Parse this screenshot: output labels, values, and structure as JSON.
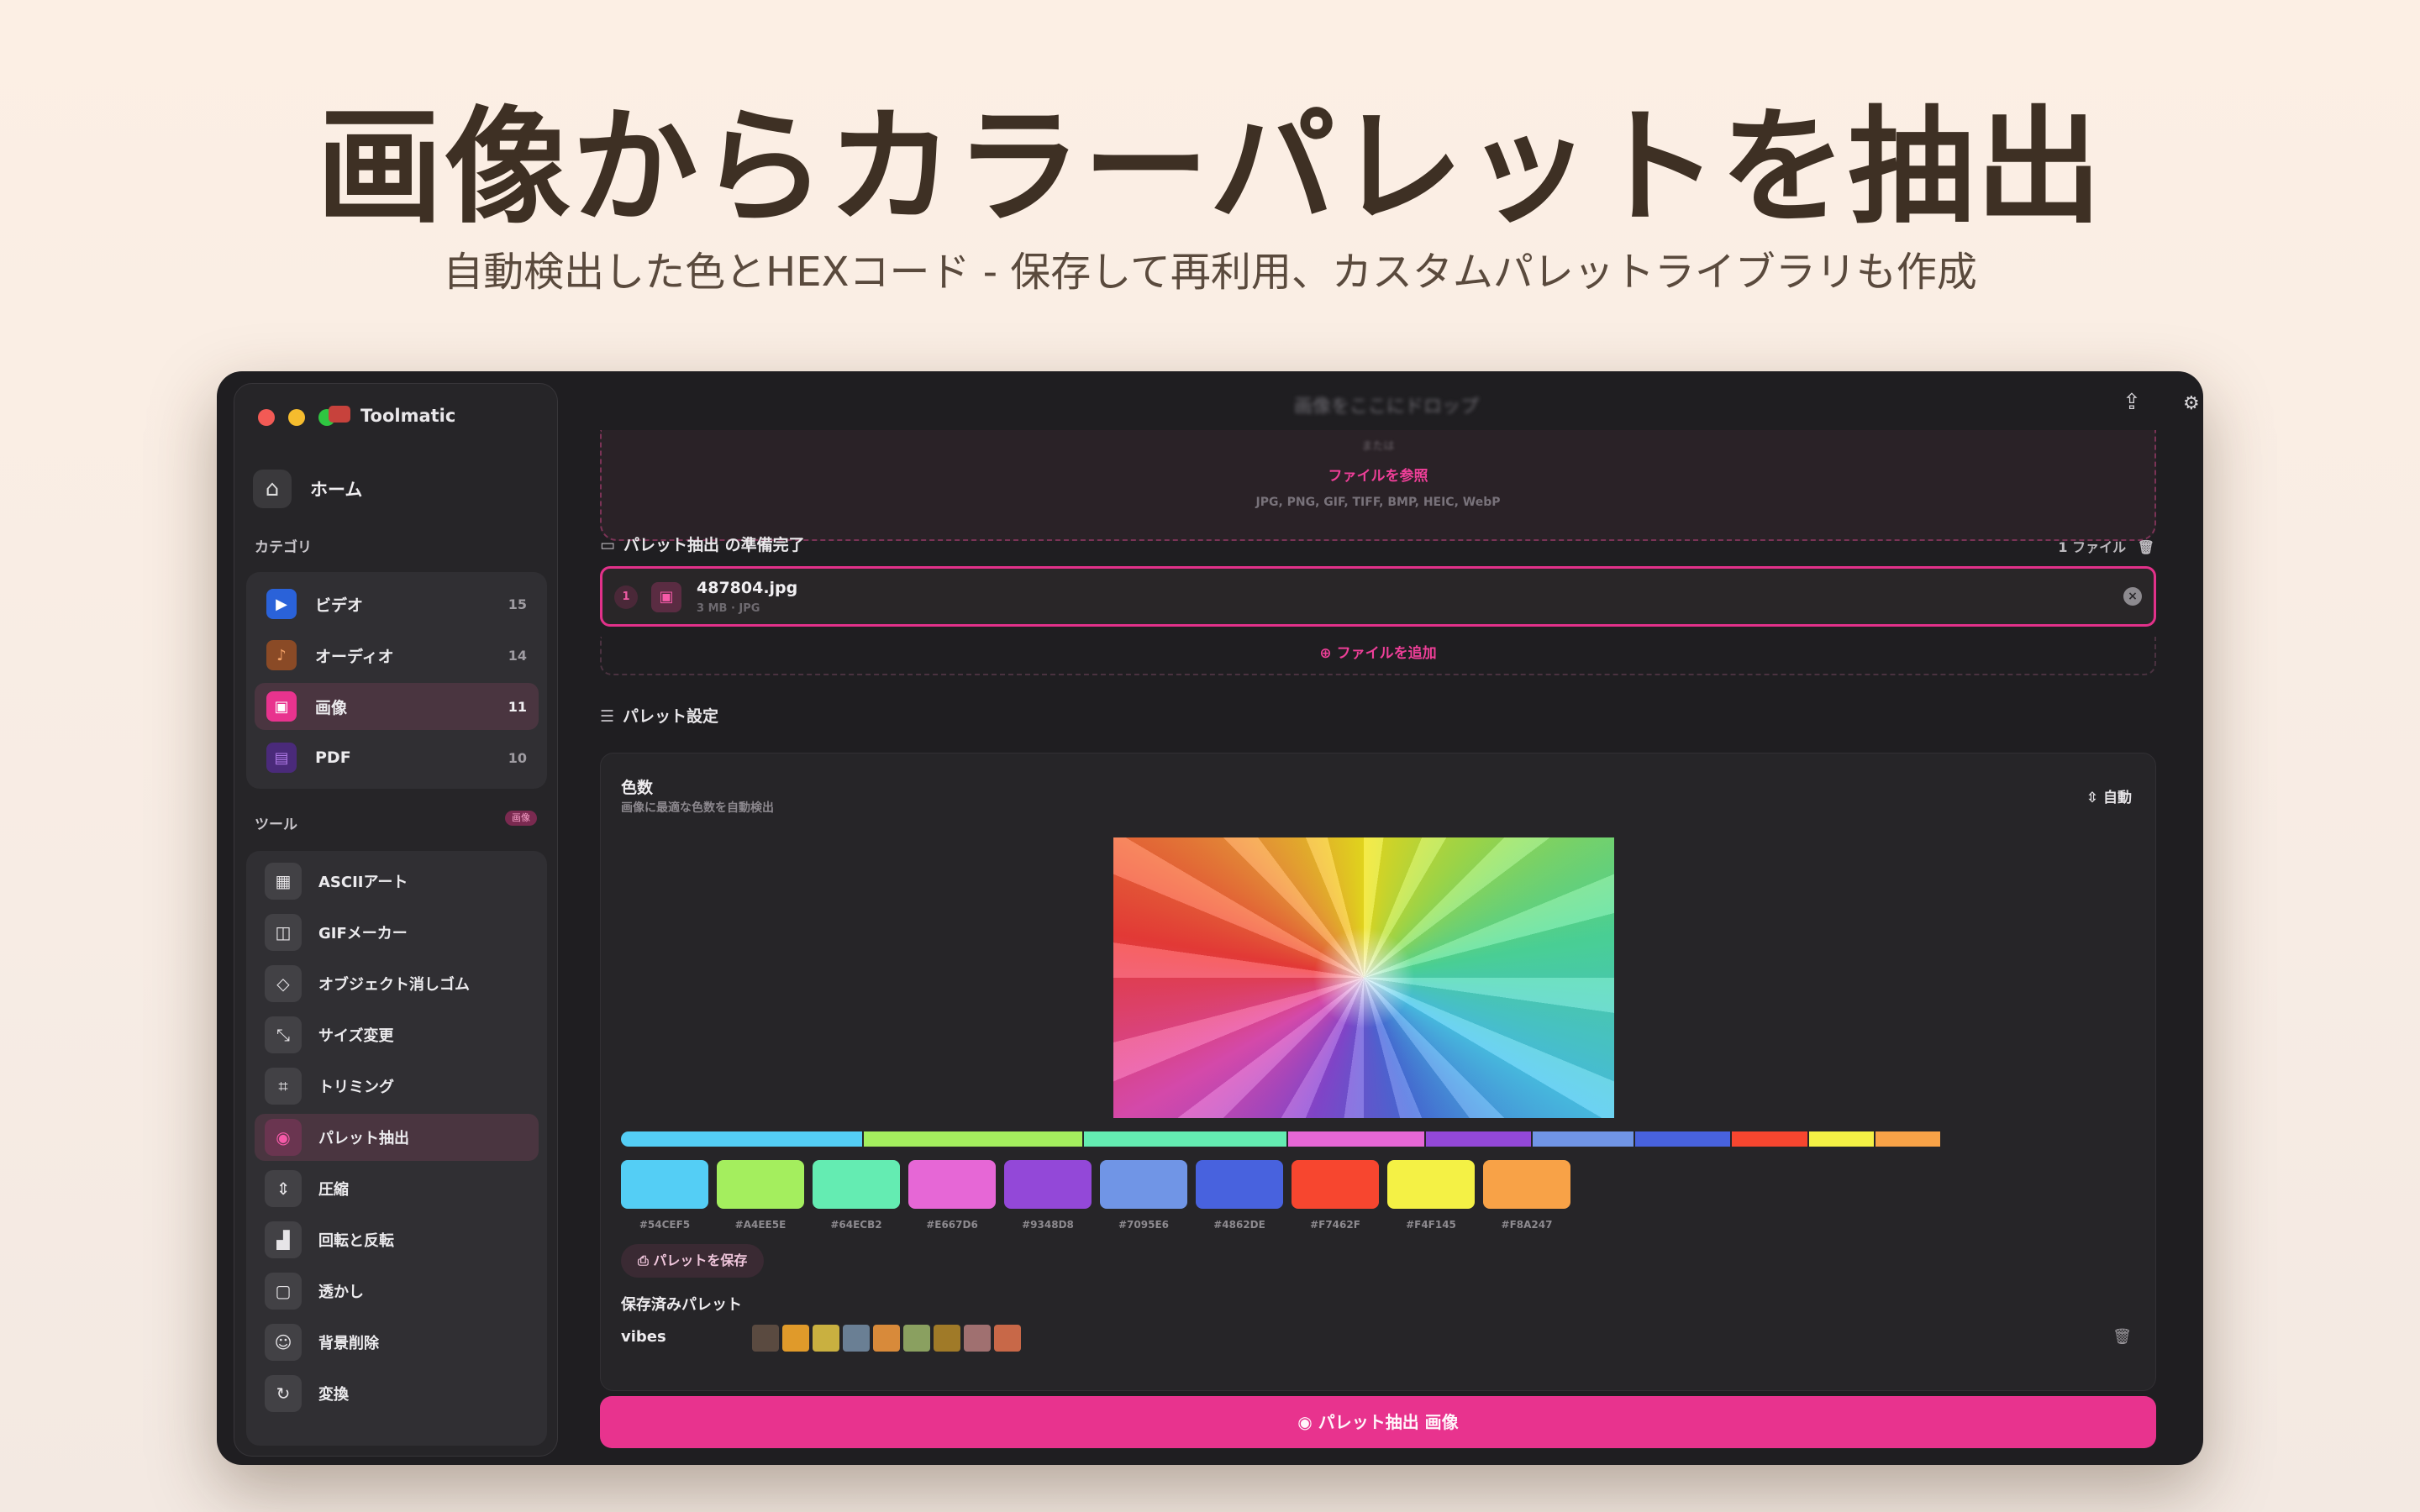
{
  "hero": {
    "title": "画像からカラーパレットを抽出",
    "subtitle": "自動検出した色とHEXコード - 保存して再利用、カスタムパレットライブラリも作成"
  },
  "app": {
    "name": "Toolmatic"
  },
  "sidebar": {
    "home_label": "ホーム",
    "categories_label": "カテゴリ",
    "categories": [
      {
        "label": "ビデオ",
        "count": "15",
        "icon": "video-icon",
        "color": "#2a62d9"
      },
      {
        "label": "オーディオ",
        "count": "14",
        "icon": "music-icon",
        "color": "#d86a2c"
      },
      {
        "label": "画像",
        "count": "11",
        "icon": "image-icon",
        "color": "#e8338e"
      },
      {
        "label": "PDF",
        "count": "10",
        "icon": "pdf-icon",
        "color": "#6a35b8"
      }
    ],
    "tools_label": "ツール",
    "tools_badge": "画像",
    "tools": [
      {
        "label": "ASCIIアート",
        "icon": "ascii-icon"
      },
      {
        "label": "GIFメーカー",
        "icon": "gif-icon"
      },
      {
        "label": "オブジェクト消しゴム",
        "icon": "eraser-icon"
      },
      {
        "label": "サイズ変更",
        "icon": "resize-icon"
      },
      {
        "label": "トリミング",
        "icon": "crop-icon"
      },
      {
        "label": "パレット抽出",
        "icon": "palette-icon"
      },
      {
        "label": "圧縮",
        "icon": "compress-icon"
      },
      {
        "label": "回転と反転",
        "icon": "rotate-icon"
      },
      {
        "label": "透かし",
        "icon": "watermark-icon"
      },
      {
        "label": "背景削除",
        "icon": "remove-background-icon"
      },
      {
        "label": "変換",
        "icon": "convert-icon"
      }
    ]
  },
  "main": {
    "drop_title": "画像をここにドロップ",
    "drop_or": "または",
    "browse_label": "ファイルを参照",
    "formats": "JPG, PNG, GIF, TIFF, BMP, HEIC, WebP",
    "ready_label": "パレット抽出 の準備完了",
    "file_count": "1 ファイル",
    "file": {
      "index": "1",
      "name": "487804.jpg",
      "meta": "3 MB · JPG"
    },
    "add_file_label": "ファイルを追加",
    "settings_label": "パレット設定",
    "color_count_title": "色数",
    "color_count_sub": "画像に最適な色数を自動検出",
    "auto_label": "自動",
    "save_palette_label": "パレットを保存",
    "saved_title": "保存済みパレット",
    "saved_palette_name": "vibes",
    "extract_button": "パレット抽出 画像"
  },
  "palette": [
    {
      "hex": "#54CEF5",
      "share": 0.16
    },
    {
      "hex": "#A4EE5E",
      "share": 0.145
    },
    {
      "hex": "#64ECB2",
      "share": 0.135
    },
    {
      "hex": "#E667D6",
      "share": 0.09
    },
    {
      "hex": "#9348D8",
      "share": 0.07
    },
    {
      "hex": "#7095E6",
      "share": 0.067
    },
    {
      "hex": "#4862DE",
      "share": 0.063
    },
    {
      "hex": "#F7462F",
      "share": 0.05
    },
    {
      "hex": "#F4F145",
      "share": 0.043
    },
    {
      "hex": "#F8A247",
      "share": 0.043
    }
  ],
  "saved_palette_colors": [
    "#5a4a40",
    "#e09a2a",
    "#c9b040",
    "#6a7f94",
    "#d88a3a",
    "#8aa060",
    "#a07a28",
    "#a07070",
    "#c86848"
  ]
}
